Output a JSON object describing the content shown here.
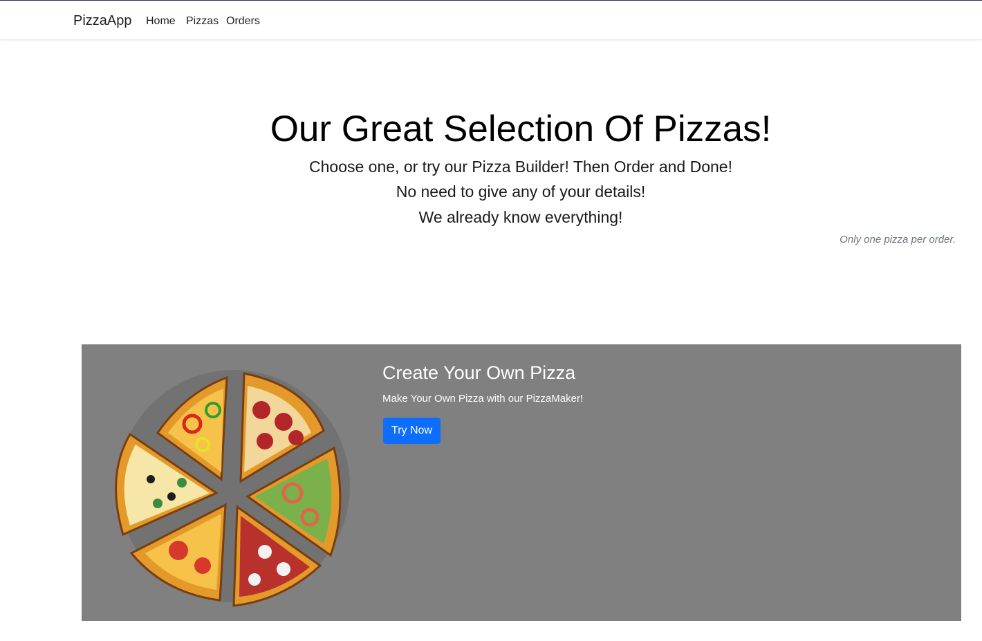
{
  "navbar": {
    "brand": "PizzaApp",
    "links": [
      "Home",
      "Pizzas",
      "Orders"
    ]
  },
  "hero": {
    "title": "Our Great Selection Of Pizzas!",
    "lines": [
      "Choose one, or try our Pizza Builder! Then Order and Done!",
      "No need to give any of your details!",
      "We already know everything!"
    ],
    "note": "Only one pizza per order."
  },
  "promo": {
    "title": "Create Your Own Pizza",
    "text": "Make Your Own Pizza with our PizzaMaker!",
    "button_label": "Try Now",
    "image": "pizza-slices-illustration"
  },
  "colors": {
    "accent": "#0d6efd",
    "card_background": "#808080"
  }
}
